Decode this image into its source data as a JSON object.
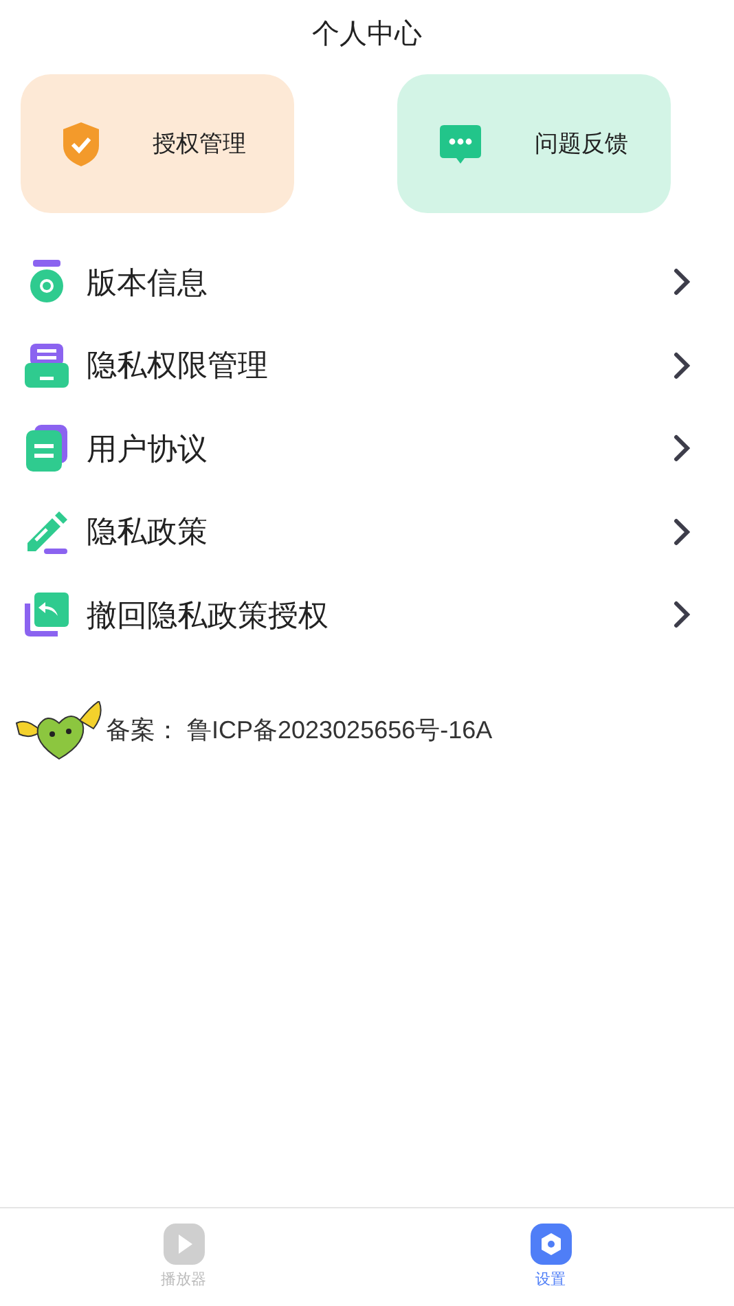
{
  "header": {
    "title": "个人中心"
  },
  "cards": [
    {
      "kind": "shield",
      "label": "授权管理"
    },
    {
      "kind": "chat",
      "label": "问题反馈"
    }
  ],
  "menu": [
    {
      "kind": "medal",
      "label": "版本信息"
    },
    {
      "kind": "tray",
      "label": "隐私权限管理"
    },
    {
      "kind": "doc",
      "label": "用户协议"
    },
    {
      "kind": "pen",
      "label": "隐私政策"
    },
    {
      "kind": "undo",
      "label": "撤回隐私政策授权"
    }
  ],
  "footer": {
    "text": "备案： 鲁ICP备2023025656号-16A"
  },
  "tabs": [
    {
      "kind": "play",
      "label": "播放器",
      "selected": false
    },
    {
      "kind": "settings",
      "label": "设置",
      "selected": true
    }
  ]
}
